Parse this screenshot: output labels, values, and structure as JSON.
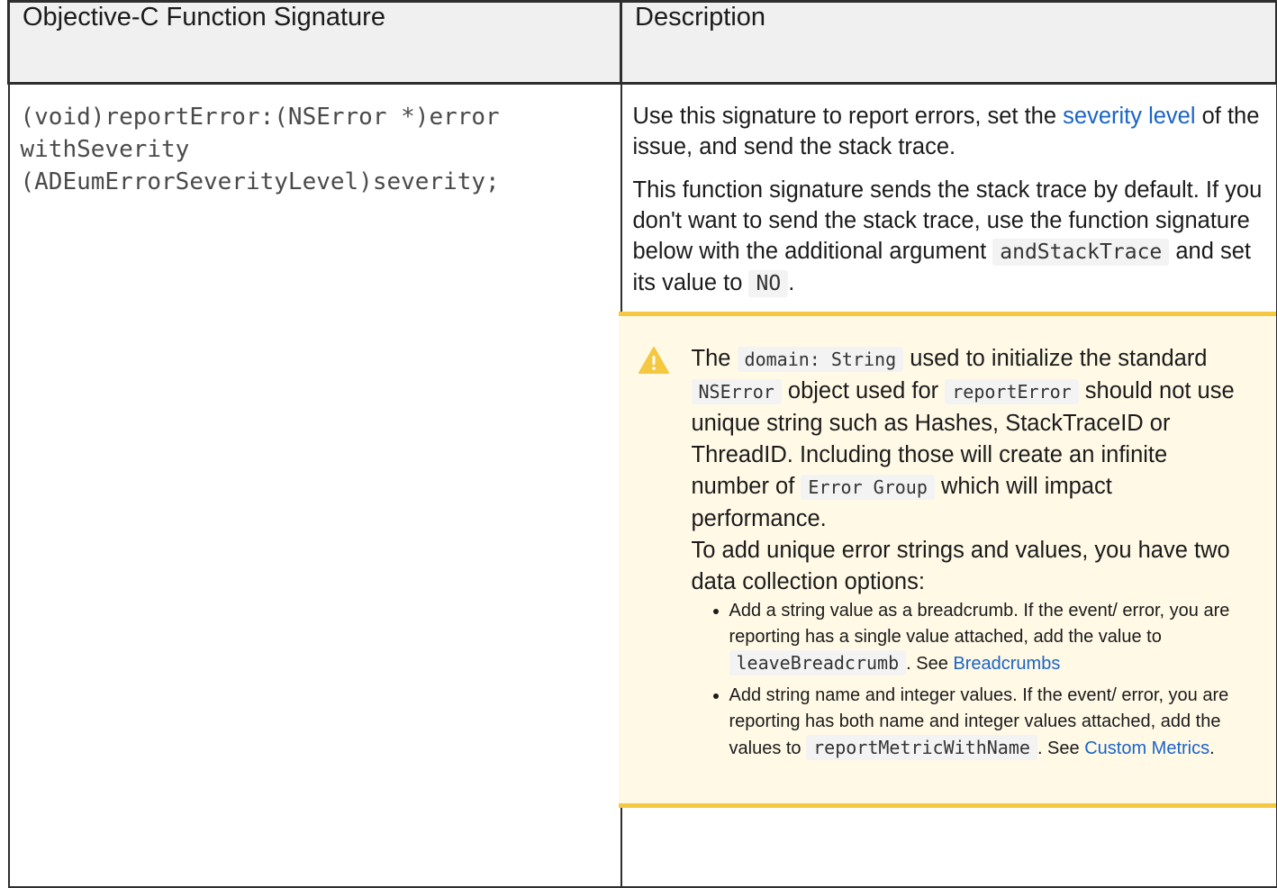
{
  "headers": [
    "Objective-C Function Signature",
    "Description"
  ],
  "signature": "(void)reportError:(NSError *)error\nwithSeverity\n(ADEumErrorSeverityLevel)severity;",
  "description": {
    "p1_pre": "Use this signature to report errors, set the ",
    "p1_link": "severity level",
    "p1_post": " of the issue, and send the stack trace.",
    "p2_pre": "This function signature sends the stack trace by default. If you don't want to send the stack trace, use the function signature below with the additional argument ",
    "p2_code1": "andStackTrace",
    "p2_mid": " and set its value to ",
    "p2_code2": "NO",
    "p2_post": "."
  },
  "note": {
    "icon": "warning-icon",
    "accent_color": "#f5c842",
    "s1": "The ",
    "c1": "domain: String",
    "s2": " used to initialize the standard ",
    "c2": "NSError",
    "s3": " object used for ",
    "c3": "reportError",
    "s4": " should not use unique string such as Hashes, StackTraceID or ThreadID. Including those will create an infinite number of ",
    "c4": "Error Group",
    "s5": " which will impact performance.",
    "s6": "To add unique error strings and values, you have two data collection options:",
    "bullets": [
      {
        "text": "Add a string value as a breadcrumb. If the event/ error, you are reporting has a single value attached, add the value to ",
        "code": "leaveBreadcrumb",
        "after": ". See ",
        "link": "Breadcrumbs",
        "end": ""
      },
      {
        "text": "Add string name and integer values. If the event/ error, you are reporting has both name and integer values attached, add the values to ",
        "code": "reportMetricWithName",
        "after": ". See ",
        "link": "Custom Metrics",
        "end": "."
      }
    ]
  }
}
